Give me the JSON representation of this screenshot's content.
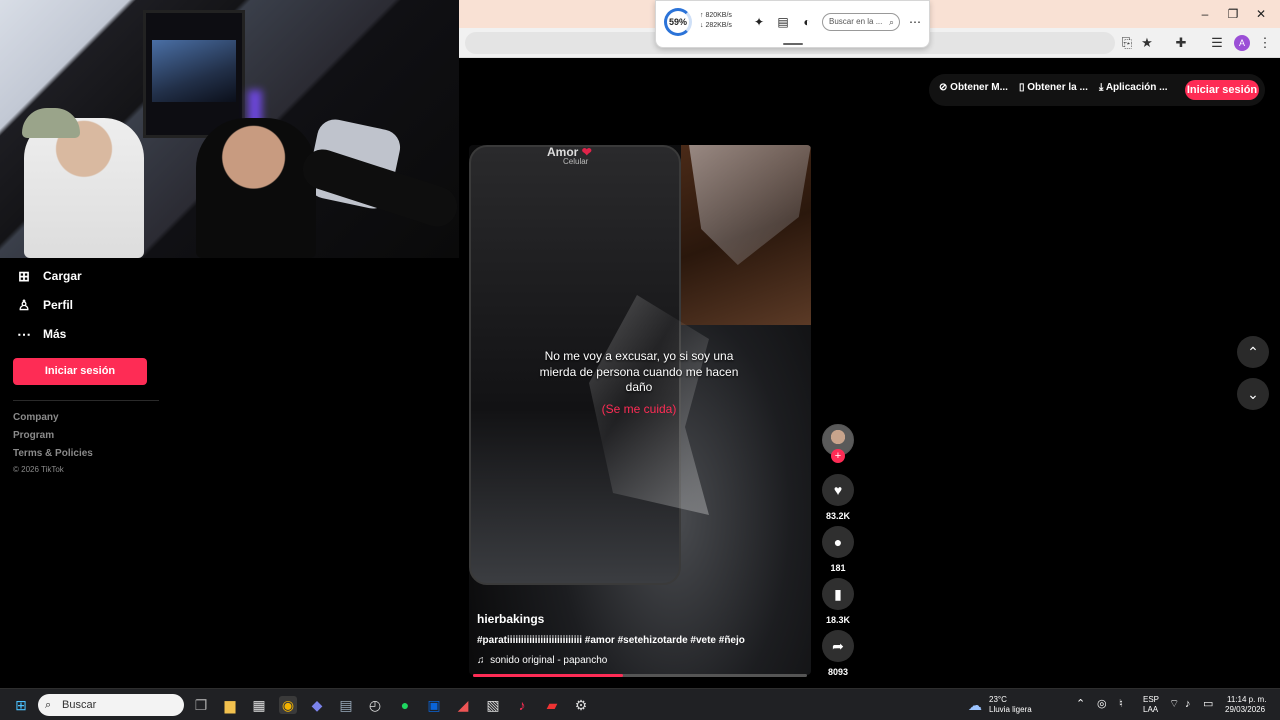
{
  "browser": {
    "popup": {
      "cpu_percent": "59%",
      "upload": "820KB/s",
      "download": "282KB/s",
      "search_placeholder": "Buscar en la ..."
    }
  },
  "header": {
    "btn1": "Obtener M...",
    "btn2": "Obtener la ...",
    "btn3": "Aplicación ...",
    "login": "Iniciar sesión"
  },
  "sidebar": {
    "items": [
      {
        "label": "Cargar",
        "icon": "upload-icon"
      },
      {
        "label": "Perfil",
        "icon": "profile-icon"
      },
      {
        "label": "Más",
        "icon": "more-icon"
      }
    ],
    "login": "Iniciar sesión",
    "footer_links": [
      "Company",
      "Program",
      "Terms & Policies"
    ],
    "copyright": "© 2026 TikTok"
  },
  "video": {
    "contact_name": "Amor",
    "contact_sub": "Celular",
    "caption": "No me voy a excusar, yo si soy una mierda de persona cuando me hacen daño",
    "caption_red": "(Se me cuida)",
    "username": "hierbakings",
    "hashtags": "#paratiiiiiiiiiiiiiiiiiiiiiiiiiii #amor #setehizotarde #vete #ñejo",
    "music": "sonido original - papancho",
    "progress": 0.45,
    "likes": "83.2K",
    "comments": "181",
    "saves": "18.3K",
    "shares": "8093"
  },
  "taskbar": {
    "search_placeholder": "Buscar",
    "weather_temp": "23°C",
    "weather_desc": "Lluvia ligera",
    "lang": "ESP",
    "lang_sub": "LAA",
    "time": "11:14 p. m.",
    "date": "29/03/2026"
  }
}
